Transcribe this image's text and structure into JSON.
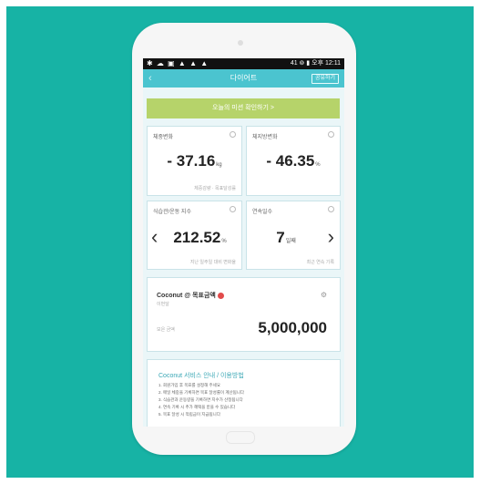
{
  "statusbar": {
    "left_icons": "✱ ☁ ▣ ▲ ▲ ▲",
    "right": "41 ⊚ ▮ 오후 12:11"
  },
  "appbar": {
    "title": "다이어트",
    "right_button": "공유하기"
  },
  "banner": {
    "label": "오늘의 미션 확인하기 >"
  },
  "cards": [
    {
      "label": "체중변화",
      "value": "- 37.16",
      "unit": "kg",
      "foot": "체중감량 · 목표달성률"
    },
    {
      "label": "체지방변화",
      "value": "- 46.35",
      "unit": "%",
      "foot": ""
    },
    {
      "label": "식습관/운동 지수",
      "value": "212.52",
      "unit": "%",
      "foot": "지난 일주일 대비 변화율"
    },
    {
      "label": "연속일수",
      "value": "7",
      "unit": "일째",
      "foot": "최근 연속 기록"
    }
  ],
  "account": {
    "name": "Coconut @ 목표금액",
    "sub": "이번달",
    "label": "모은 금액",
    "amount": "5,000,000"
  },
  "notice": {
    "title": "Coconut 서비스 안내 / 이용방법",
    "items": [
      "1. 회원가입 후 목표를 설정해 주세요",
      "2. 매일 체중을 기록하면 목표 달성률이 계산됩니다",
      "3. 식습관과 운동량을 기록하면 지수가 산정됩니다",
      "4. 연속 기록 시 추가 혜택을 받을 수 있습니다",
      "5. 목표 달성 시 적립금이 지급됩니다"
    ]
  },
  "colors": {
    "background": "#17b3a5",
    "appbar": "#4bc4cf",
    "banner": "#b6d36a",
    "badge": "#e24b4b"
  }
}
